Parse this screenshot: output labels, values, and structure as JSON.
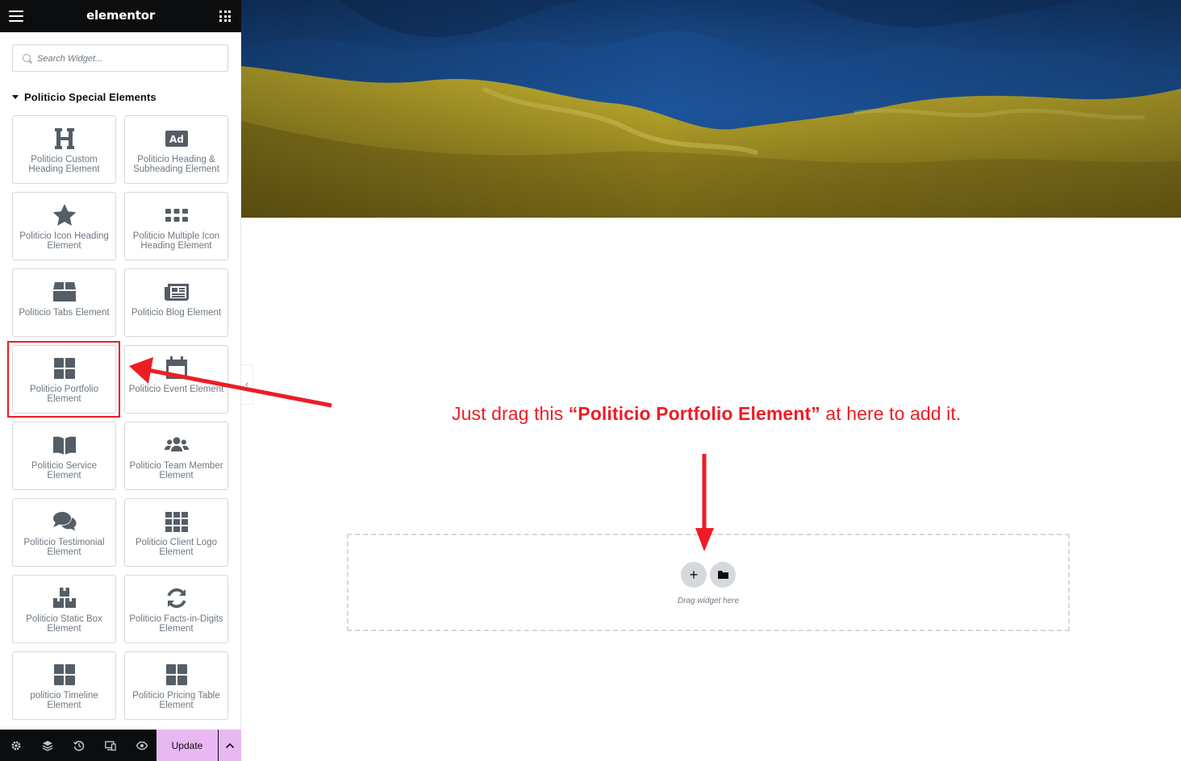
{
  "app": {
    "logo": "elementor",
    "menu_icon": "hamburger-icon",
    "apps_icon": "grid-icon"
  },
  "search": {
    "placeholder": "Search Widget..."
  },
  "panel": {
    "category_label": "Politicio Special Elements",
    "widgets": [
      {
        "label": "Politicio Custom Heading Element",
        "icon": "heading-icon"
      },
      {
        "label": "Politicio Heading & Subheading Element",
        "icon": "ad-icon"
      },
      {
        "label": "Politicio Icon Heading Element",
        "icon": "star-icon"
      },
      {
        "label": "Politicio Multiple Icon Heading Element",
        "icon": "dots-grid-icon"
      },
      {
        "label": "Politicio Tabs Element",
        "icon": "box-icon"
      },
      {
        "label": "Politicio Blog Element",
        "icon": "newspaper-icon"
      },
      {
        "label": "Politicio Portfolio Element",
        "icon": "th-large-icon"
      },
      {
        "label": "Politicio Event Element",
        "icon": "calendar-icon"
      },
      {
        "label": "Politicio Service Element",
        "icon": "book-open-icon"
      },
      {
        "label": "Politicio Team Member Element",
        "icon": "users-icon"
      },
      {
        "label": "Politicio Testimonial Element",
        "icon": "comments-icon"
      },
      {
        "label": "Politicio Client Logo Element",
        "icon": "th-icon"
      },
      {
        "label": "Politicio Static Box Element",
        "icon": "boxes-icon"
      },
      {
        "label": "Politicio Facts-in-Digits Element",
        "icon": "sync-icon"
      },
      {
        "label": "politicio Timeline Element",
        "icon": "th-large-icon"
      },
      {
        "label": "Politicio Pricing Table Element",
        "icon": "th-large-icon"
      }
    ]
  },
  "footer": {
    "update_label": "Update",
    "tools": [
      "settings-icon",
      "navigator-icon",
      "history-icon",
      "responsive-icon",
      "preview-icon"
    ]
  },
  "canvas": {
    "instruction_pre": "Just drag this ",
    "instruction_bold": "“Politicio Portfolio Element”",
    "instruction_post": " at here to add it.",
    "dropzone_text": "Drag widget here",
    "add_symbol": "+"
  },
  "colors": {
    "annotation_red": "#ee1c25",
    "update_button": "#e8b8f2",
    "flag_blue": "#1d5aa3",
    "flag_yellow": "#b8a42a"
  }
}
